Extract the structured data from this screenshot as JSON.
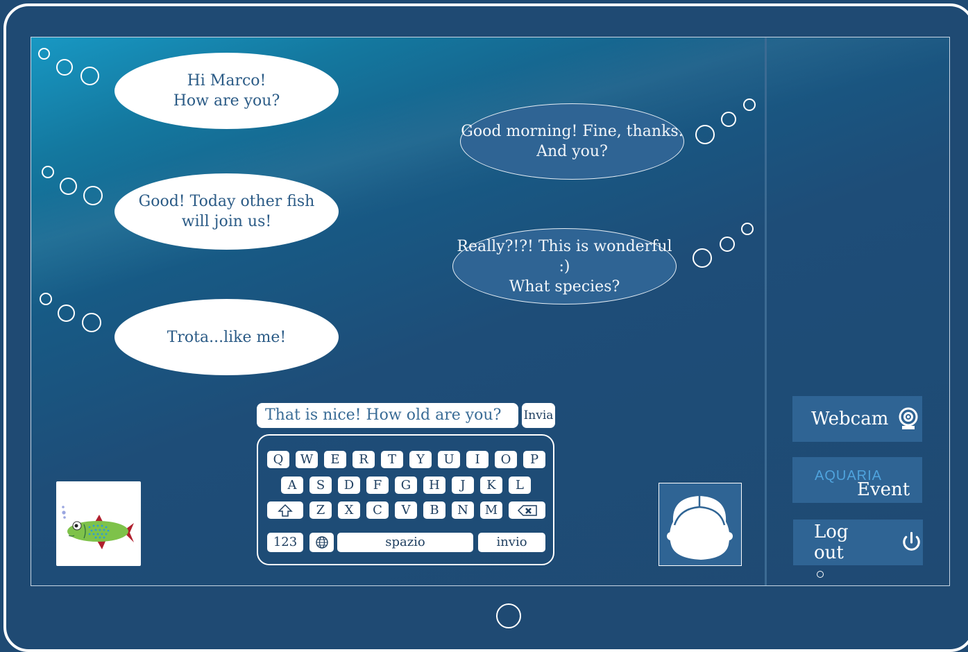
{
  "chat": {
    "incoming": [
      {
        "text": "Hi Marco!\nHow are you?"
      },
      {
        "text": "Good! Today other fish\nwill join us!"
      },
      {
        "text": "Trota...like me!"
      }
    ],
    "outgoing": [
      {
        "text": "Good morning! Fine, thanks.\nAnd you?"
      },
      {
        "text": "Really?!?! This is wonderful :)\nWhat species?"
      }
    ]
  },
  "composer": {
    "input_value": "That is nice! How old are you?",
    "send_label": "Invia"
  },
  "keyboard": {
    "row1": [
      "Q",
      "W",
      "E",
      "R",
      "T",
      "Y",
      "U",
      "I",
      "O",
      "P"
    ],
    "row2": [
      "A",
      "S",
      "D",
      "F",
      "G",
      "H",
      "J",
      "K",
      "L"
    ],
    "row3": [
      "Z",
      "X",
      "C",
      "V",
      "B",
      "N",
      "M"
    ],
    "numbers_label": "123",
    "space_label": "spazio",
    "enter_label": "invio"
  },
  "sidebar": {
    "webcam_label": "Webcam",
    "logo_brand": "AQUARIA",
    "logo_sub": "Event",
    "logout_label": "Log out"
  },
  "colors": {
    "background": "#1f4a73",
    "bubble_incoming": "#ffffff",
    "bubble_outgoing": "#2f6494",
    "button_fill": "#2f6494"
  },
  "icons": {
    "webcam": "webcam-icon",
    "power": "power-icon",
    "globe": "globe-icon",
    "shift": "shift-arrow-icon",
    "backspace": "backspace-icon"
  }
}
